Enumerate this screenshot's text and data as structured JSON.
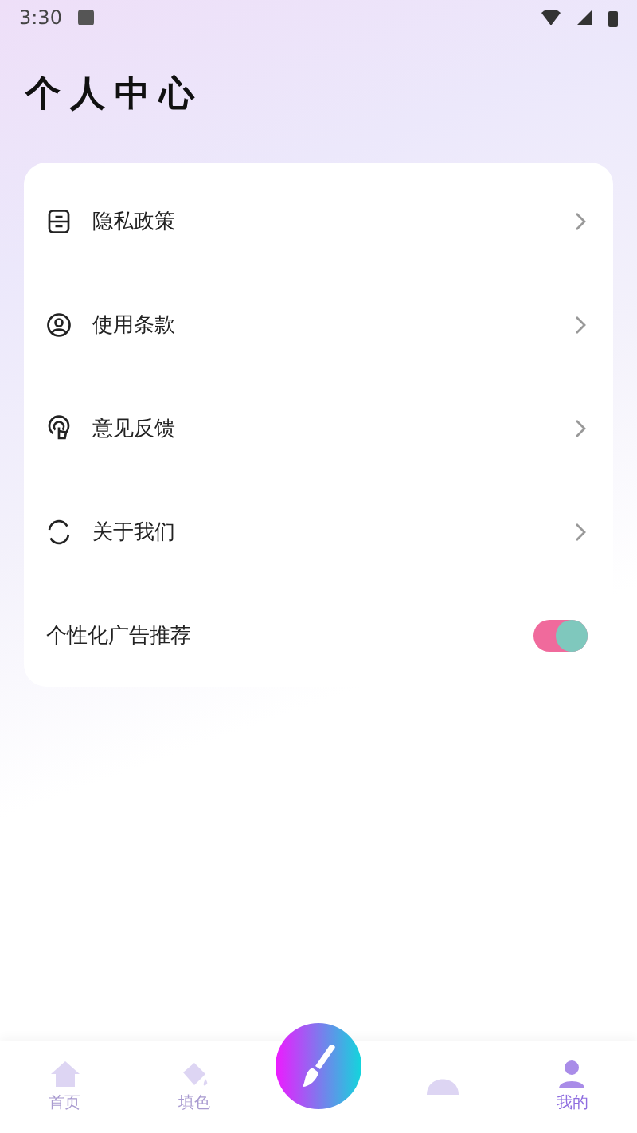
{
  "status_bar": {
    "time": "3:30"
  },
  "title": "个人中心",
  "menu": [
    {
      "kind": "link",
      "label": "隐私政策"
    },
    {
      "kind": "link",
      "label": "使用条款"
    },
    {
      "kind": "link",
      "label": "意见反馈"
    },
    {
      "kind": "link",
      "label": "关于我们"
    },
    {
      "kind": "switch",
      "label": "个性化广告推荐",
      "on": true
    }
  ],
  "tabs": [
    {
      "kind": "tab",
      "label": "首页",
      "selected": false
    },
    {
      "kind": "tab",
      "label": "填色",
      "selected": false
    },
    {
      "kind": "fab",
      "selected": false
    },
    {
      "kind": "tab",
      "selected": false
    },
    {
      "kind": "tab",
      "label": "我的",
      "selected": true
    }
  ]
}
